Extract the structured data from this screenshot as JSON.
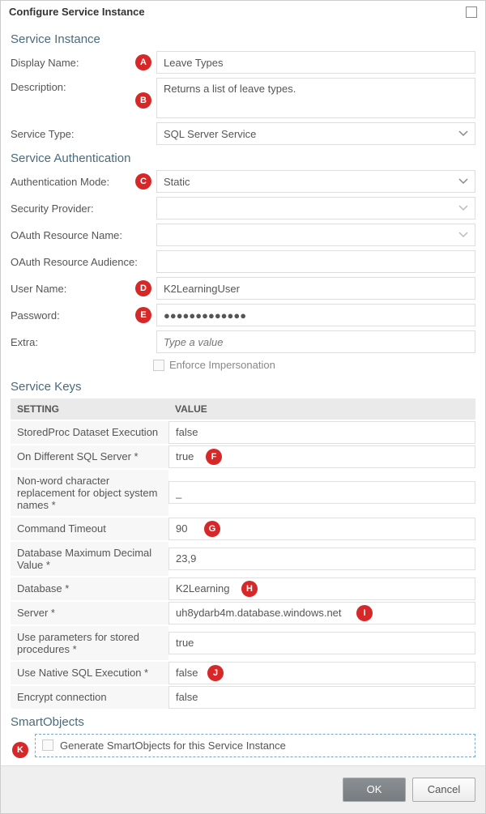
{
  "dialog": {
    "title": "Configure Service Instance"
  },
  "sections": {
    "service_instance": "Service Instance",
    "service_auth": "Service Authentication",
    "service_keys": "Service Keys",
    "smartobjects": "SmartObjects"
  },
  "instance": {
    "display_name_label": "Display Name:",
    "display_name": "Leave Types",
    "description_label": "Description:",
    "description": "Returns a list of leave types.",
    "service_type_label": "Service Type:",
    "service_type": "SQL Server Service"
  },
  "auth": {
    "mode_label": "Authentication Mode:",
    "mode": "Static",
    "security_provider_label": "Security Provider:",
    "security_provider": "",
    "oauth_name_label": "OAuth Resource Name:",
    "oauth_name": "",
    "oauth_audience_label": "OAuth Resource Audience:",
    "oauth_audience": "",
    "username_label": "User Name:",
    "username": "K2LearningUser",
    "password_label": "Password:",
    "password": "●●●●●●●●●●●●●",
    "extra_label": "Extra:",
    "extra_placeholder": "Type a value",
    "enforce_label": "Enforce Impersonation"
  },
  "service_keys": {
    "header_setting": "SETTING",
    "header_value": "VALUE",
    "rows": [
      {
        "setting": "StoredProc Dataset Execution",
        "value": "false"
      },
      {
        "setting": "On Different SQL Server *",
        "value": "true"
      },
      {
        "setting": "Non-word character replacement for object system names *",
        "value": "_"
      },
      {
        "setting": "Command Timeout",
        "value": "90"
      },
      {
        "setting": "Database Maximum Decimal Value *",
        "value": "23,9"
      },
      {
        "setting": "Database *",
        "value": "K2Learning"
      },
      {
        "setting": "Server *",
        "value": "uh8ydarb4m.database.windows.net"
      },
      {
        "setting": "Use parameters for stored procedures *",
        "value": "true"
      },
      {
        "setting": "Use Native SQL Execution *",
        "value": "false"
      },
      {
        "setting": "Encrypt connection",
        "value": "false"
      }
    ]
  },
  "smartobjects": {
    "label": "Generate SmartObjects for this Service Instance"
  },
  "footer": {
    "ok": "OK",
    "cancel": "Cancel"
  },
  "annotations": {
    "A": "A",
    "B": "B",
    "C": "C",
    "D": "D",
    "E": "E",
    "F": "F",
    "G": "G",
    "H": "H",
    "I": "I",
    "J": "J",
    "K": "K"
  }
}
